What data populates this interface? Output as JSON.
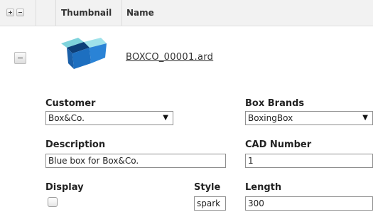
{
  "header": {
    "thumbnail_label": "Thumbnail",
    "name_label": "Name"
  },
  "row": {
    "file_name": "BOXCO_00001.ard"
  },
  "form": {
    "customer": {
      "label": "Customer",
      "value": "Box&Co."
    },
    "box_brands": {
      "label": "Box Brands",
      "value": "BoxingBox"
    },
    "description": {
      "label": "Description",
      "value": "Blue box for Box&Co."
    },
    "cad_number": {
      "label": "CAD Number",
      "value": "1"
    },
    "display": {
      "label": "Display",
      "checked": false
    },
    "style": {
      "label": "Style",
      "value": "spark"
    },
    "length": {
      "label": "Length",
      "value": "300"
    }
  },
  "icons": {
    "select_arrow": "▼",
    "thumbnail_color": "#1a5fa8"
  }
}
